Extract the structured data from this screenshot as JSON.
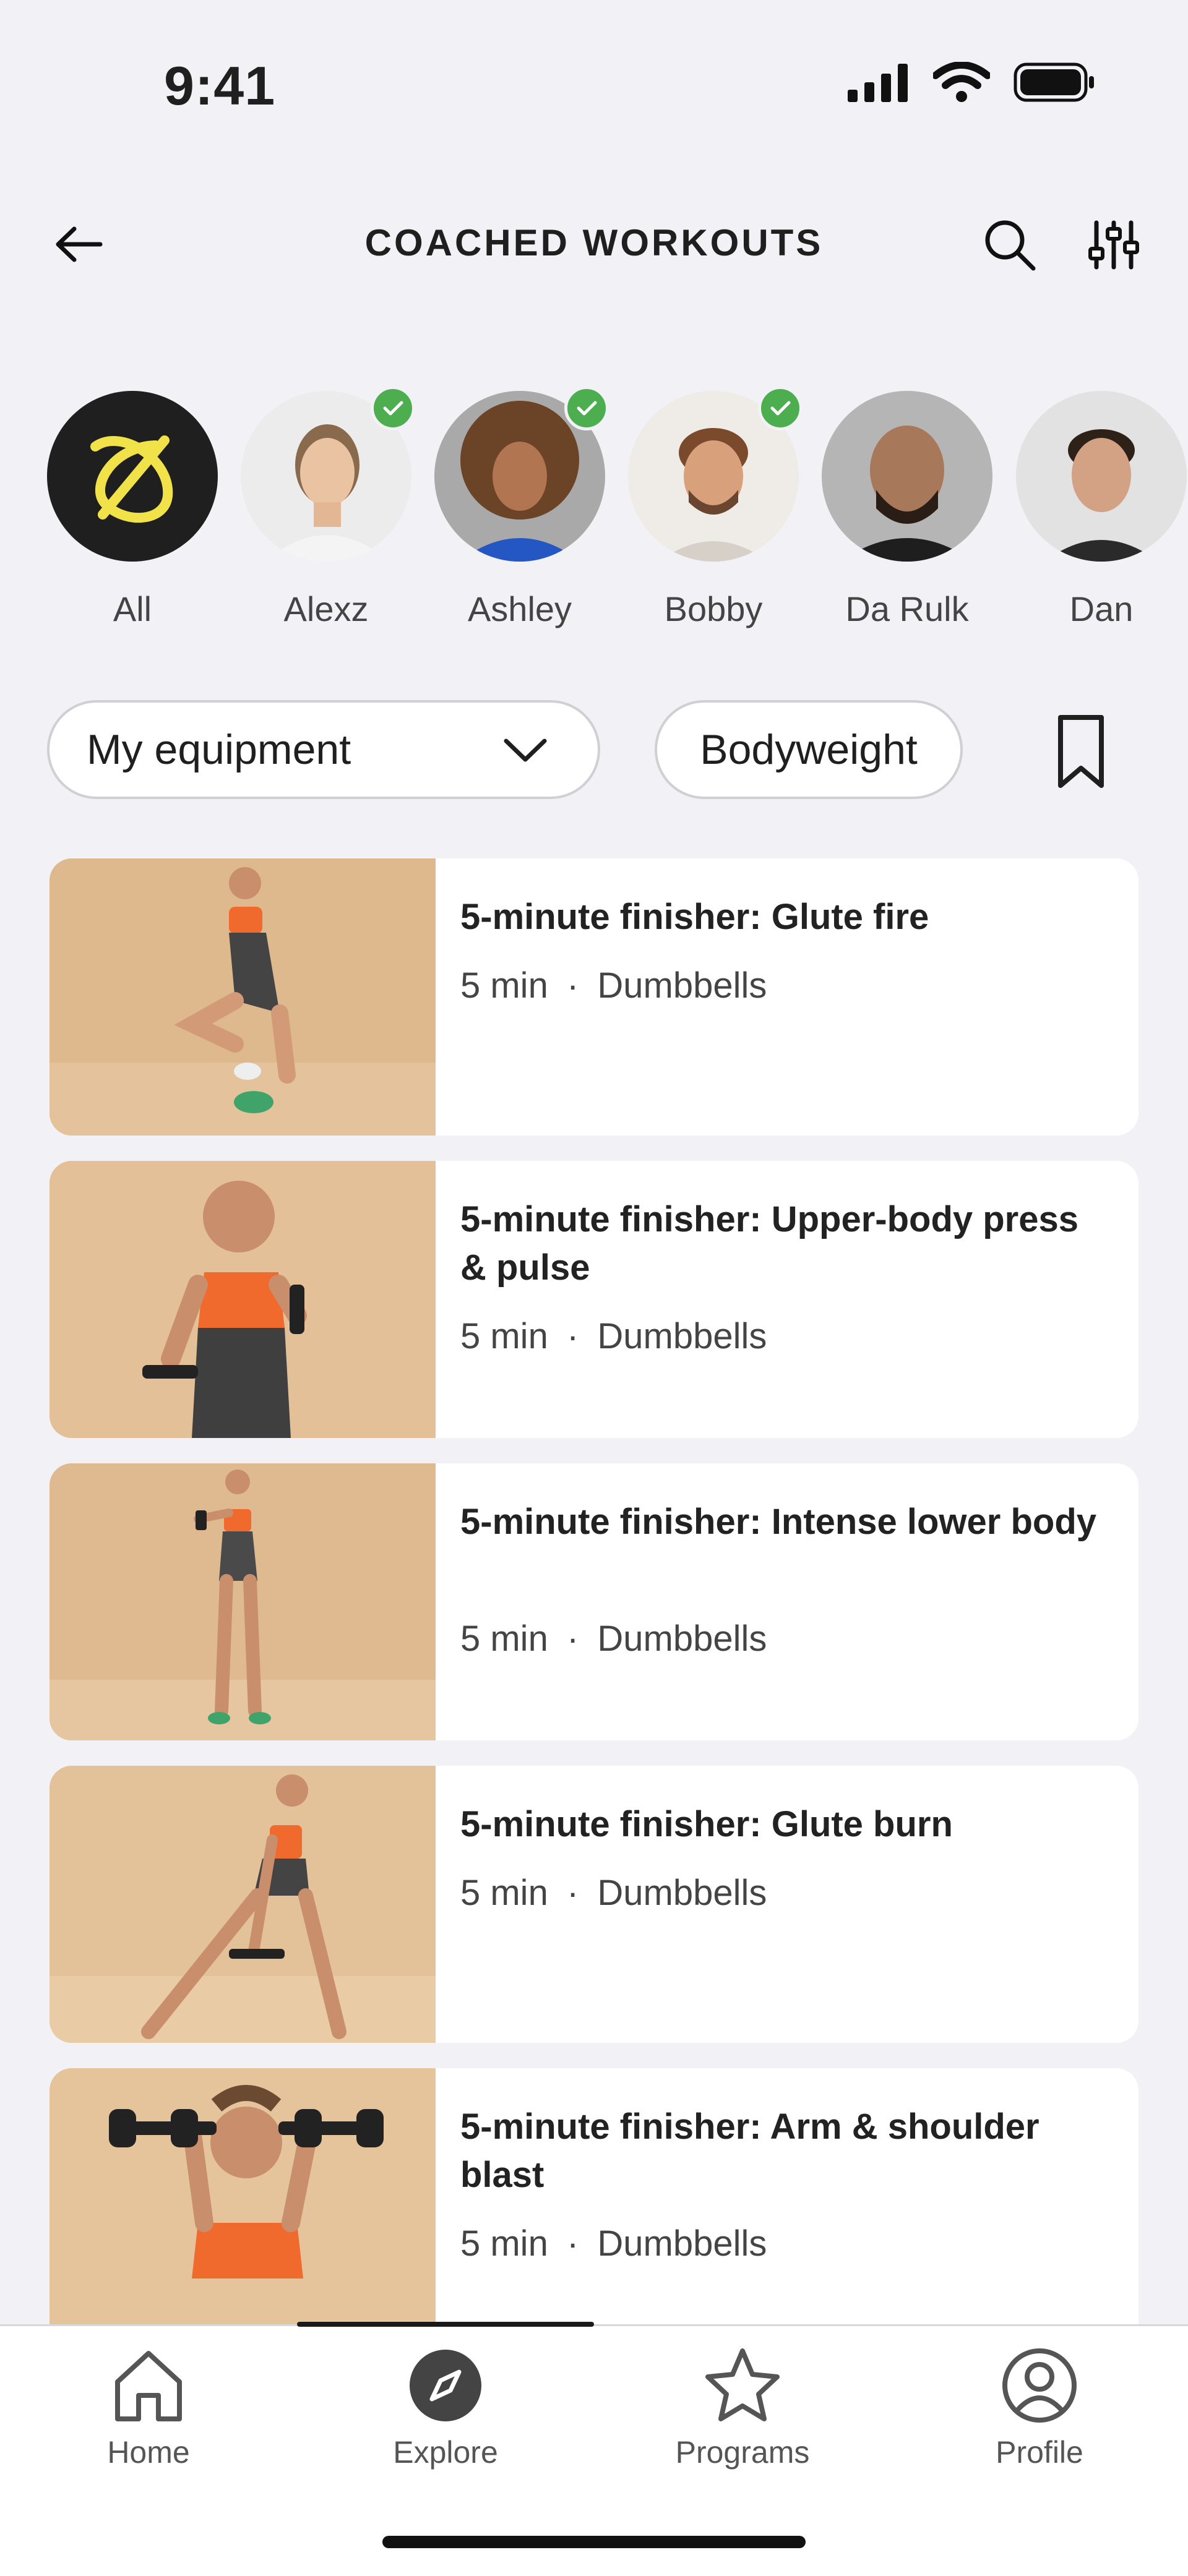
{
  "status_bar": {
    "time": "9:41"
  },
  "header": {
    "title": "COACHED WORKOUTS"
  },
  "coaches": [
    {
      "name": "All",
      "selected": false,
      "checked": false
    },
    {
      "name": "Alexz",
      "checked": true
    },
    {
      "name": "Ashley",
      "checked": true
    },
    {
      "name": "Bobby",
      "checked": true
    },
    {
      "name": "Da Rulk",
      "checked": false
    },
    {
      "name": "Dan",
      "checked": false
    }
  ],
  "filters": {
    "equipment_label": "My equipment",
    "bodyweight_label": "Bodyweight"
  },
  "workouts": [
    {
      "title": "5-minute finisher: Glute fire",
      "duration": "5 min",
      "sep": "·",
      "equipment": "Dumbbells"
    },
    {
      "title": "5-minute finisher: Upper-body press & pulse",
      "duration": "5 min",
      "sep": "·",
      "equipment": "Dumbbells"
    },
    {
      "title": "5-minute finisher: Intense lower body",
      "duration": "5 min",
      "sep": "·",
      "equipment": "Dumbbells"
    },
    {
      "title": "5-minute finisher: Glute burn",
      "duration": "5 min",
      "sep": "·",
      "equipment": "Dumbbells"
    },
    {
      "title": "5-minute finisher: Arm & shoulder blast",
      "duration": "5 min",
      "sep": "·",
      "equipment": "Dumbbells"
    }
  ],
  "tabbar": {
    "items": [
      {
        "label": "Home",
        "icon": "home-icon",
        "active": false
      },
      {
        "label": "Explore",
        "icon": "compass-icon",
        "active": true
      },
      {
        "label": "Programs",
        "icon": "star-icon",
        "active": false
      },
      {
        "label": "Profile",
        "icon": "profile-icon",
        "active": false
      }
    ]
  },
  "colors": {
    "background": "#f2f2f6",
    "accent_yellow": "#f2e24a",
    "check_green": "#4cae4f",
    "sports_bra_orange": "#f06a2e"
  }
}
